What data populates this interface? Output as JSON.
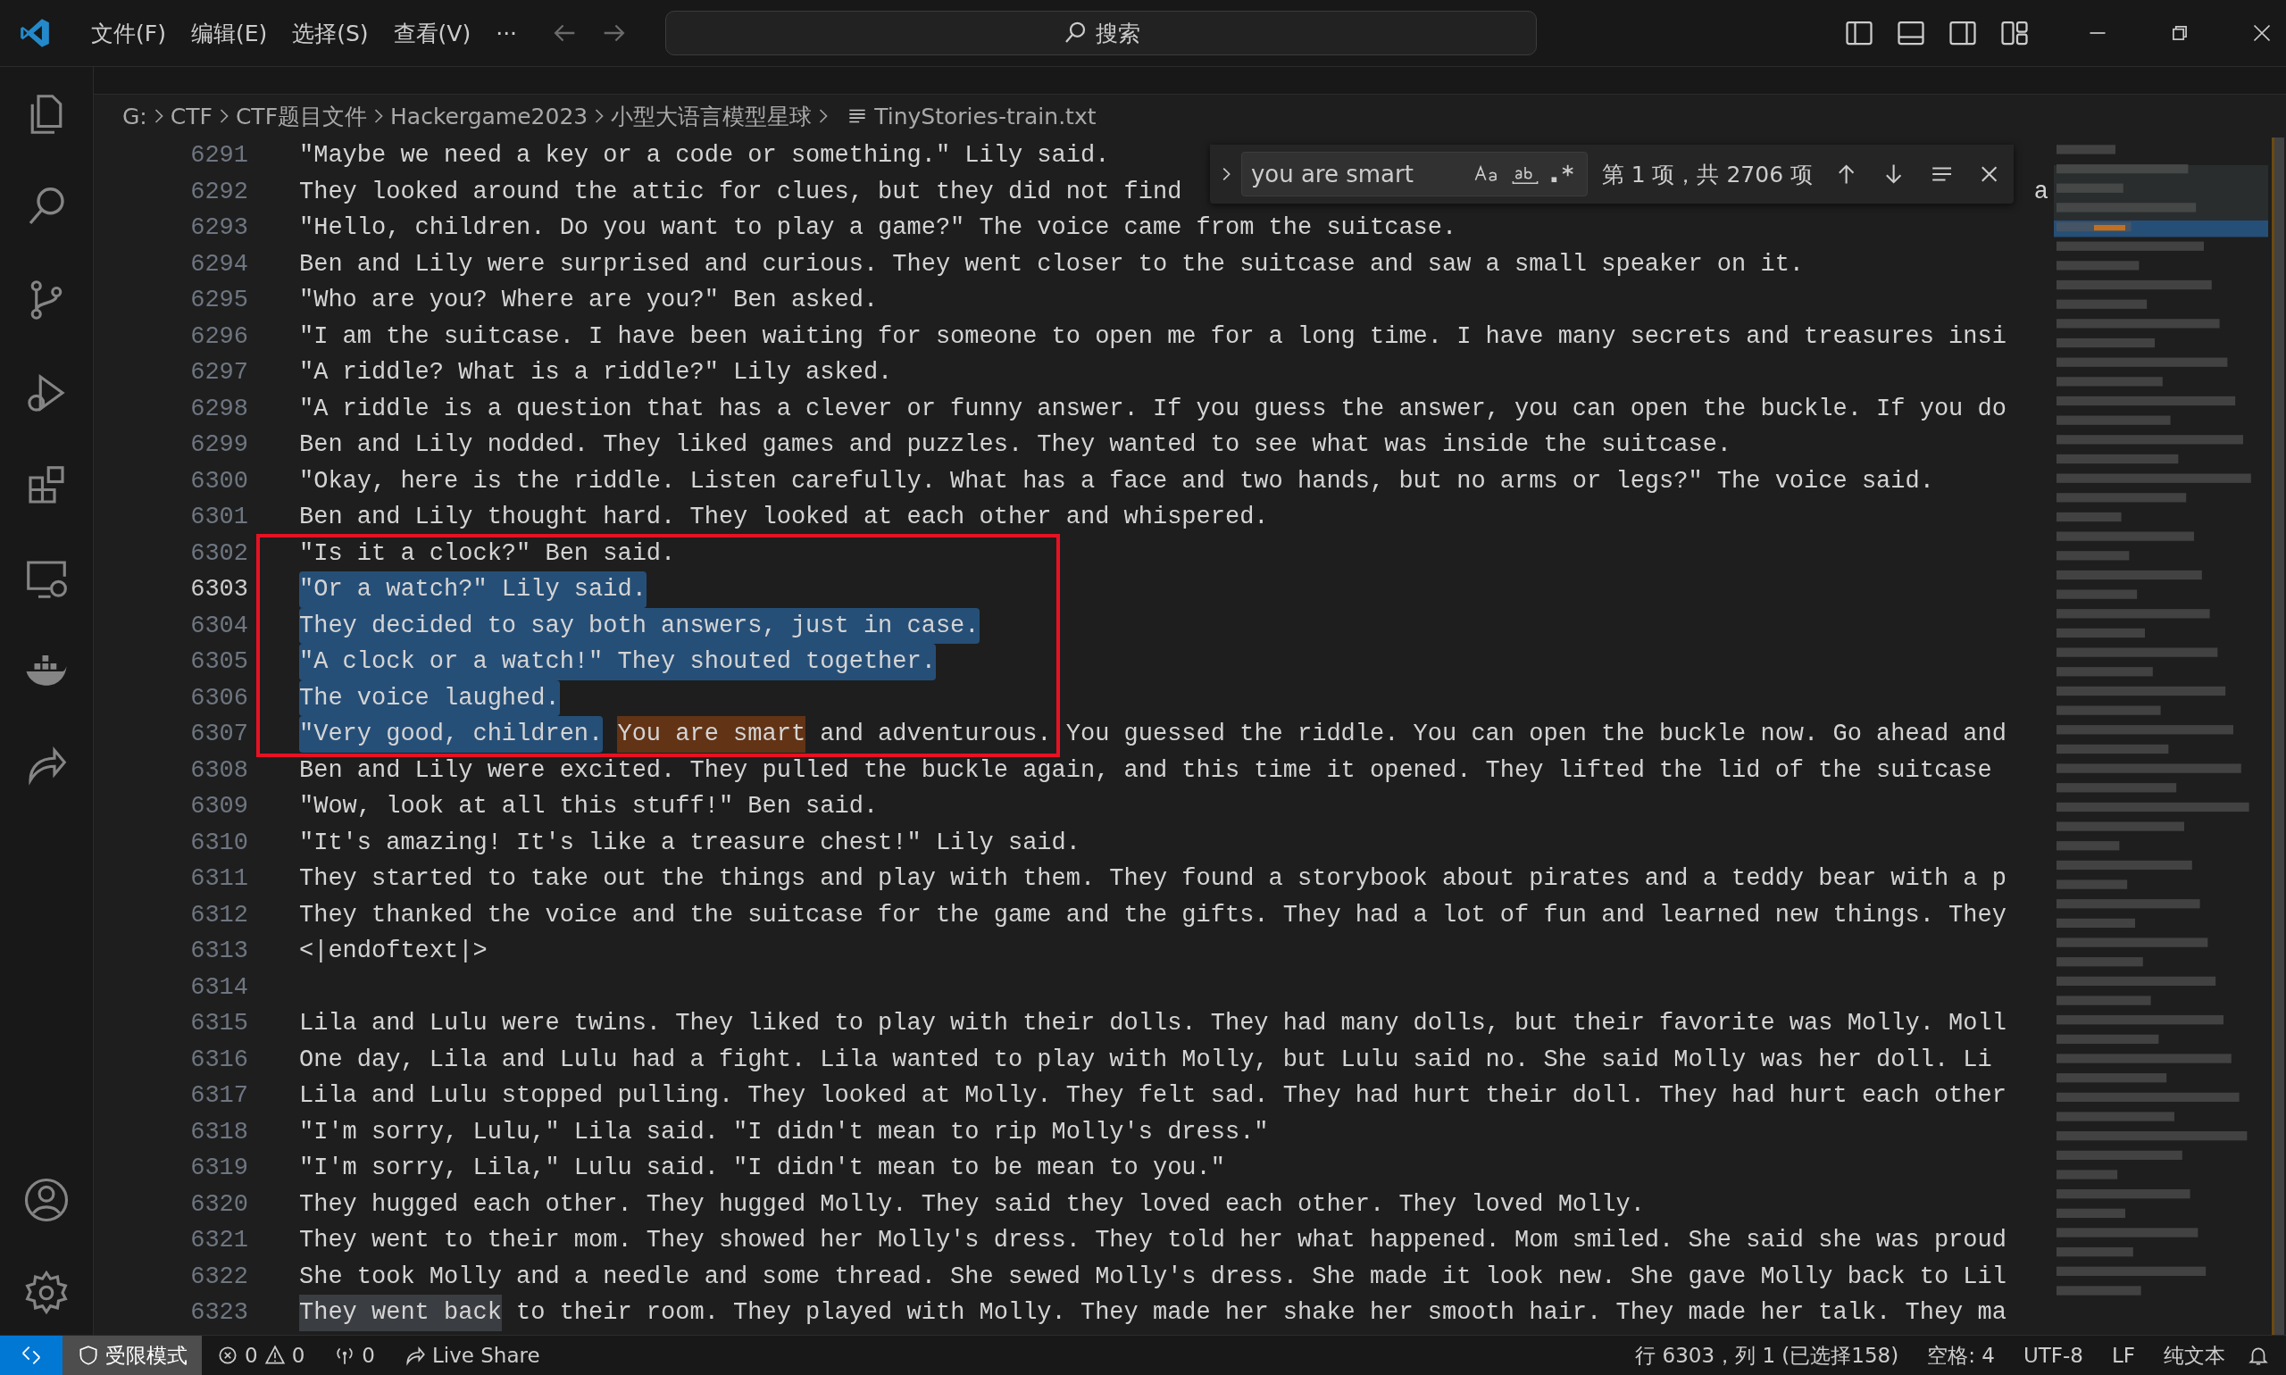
{
  "title_bar": {
    "menus": [
      "文件(F)",
      "编辑(E)",
      "选择(S)",
      "查看(V)"
    ],
    "more": "···",
    "search": "搜索"
  },
  "breadcrumb": [
    "G:",
    "CTF",
    "CTF题目文件",
    "Hackergame2023",
    "小型大语言模型星球",
    "TinyStories-train.txt"
  ],
  "find": {
    "value": "you are smart",
    "match_case": false,
    "whole_word": false,
    "regex": false,
    "result": "第 1 项，共 2706 项"
  },
  "annotation": {
    "kind": "rectangle"
  },
  "editor": {
    "lines": [
      {
        "number": "6291",
        "current": false,
        "segments": [
          {
            "kind": "plain",
            "text": "\"Maybe we need a key or a code or something.\" Lily said."
          }
        ]
      },
      {
        "number": "6292",
        "current": false,
        "segments": [
          {
            "kind": "plain",
            "text": "They looked around the attic for clues, but they did not find"
          }
        ],
        "tail": "a"
      },
      {
        "number": "6293",
        "current": false,
        "segments": [
          {
            "kind": "plain",
            "text": "\"Hello, children. Do you want to play a game?\" The voice came from the suitcase."
          }
        ]
      },
      {
        "number": "6294",
        "current": false,
        "segments": [
          {
            "kind": "plain",
            "text": "Ben and Lily were surprised and curious. They went closer to the suitcase and saw a small speaker on it."
          }
        ]
      },
      {
        "number": "6295",
        "current": false,
        "segments": [
          {
            "kind": "plain",
            "text": "\"Who are you? Where are you?\" Ben asked."
          }
        ]
      },
      {
        "number": "6296",
        "current": false,
        "segments": [
          {
            "kind": "plain",
            "text": "\"I am the suitcase. I have been waiting for someone to open me for a long time. I have many secrets and treasures insi"
          }
        ]
      },
      {
        "number": "6297",
        "current": false,
        "segments": [
          {
            "kind": "plain",
            "text": "\"A riddle? What is a riddle?\" Lily asked."
          }
        ]
      },
      {
        "number": "6298",
        "current": false,
        "segments": [
          {
            "kind": "plain",
            "text": "\"A riddle is a question that has a clever or funny answer. If you guess the answer, you can open the buckle. If you do"
          }
        ]
      },
      {
        "number": "6299",
        "current": false,
        "segments": [
          {
            "kind": "plain",
            "text": "Ben and Lily nodded. They liked games and puzzles. They wanted to see what was inside the suitcase."
          }
        ]
      },
      {
        "number": "6300",
        "current": false,
        "segments": [
          {
            "kind": "plain",
            "text": "\"Okay, here is the riddle. Listen carefully. What has a face and two hands, but no arms or legs?\" The voice said."
          }
        ]
      },
      {
        "number": "6301",
        "current": false,
        "segments": [
          {
            "kind": "plain",
            "text": "Ben and Lily thought hard. They looked at each other and whispered."
          }
        ]
      },
      {
        "number": "6302",
        "current": false,
        "segments": [
          {
            "kind": "plain",
            "text": "\"Is it a clock?\" Ben said."
          }
        ]
      },
      {
        "number": "6303",
        "current": true,
        "segments": [
          {
            "kind": "selection",
            "text": "\"Or a watch?\" Lily said."
          }
        ]
      },
      {
        "number": "6304",
        "current": false,
        "segments": [
          {
            "kind": "selection",
            "text": "They decided to say both answers, just in case."
          }
        ]
      },
      {
        "number": "6305",
        "current": false,
        "segments": [
          {
            "kind": "selection",
            "text": "\"A clock or a watch!\" They shouted together."
          }
        ]
      },
      {
        "number": "6306",
        "current": false,
        "segments": [
          {
            "kind": "selection",
            "text": "The voice laughed."
          }
        ]
      },
      {
        "number": "6307",
        "current": false,
        "segments": [
          {
            "kind": "selection",
            "text": "\"Very good, children."
          },
          {
            "kind": "match",
            "text": "You are smart"
          },
          {
            "kind": "plain",
            "text": " and adventurous. You guessed the riddle. You can open the buckle now. Go ahead and"
          }
        ]
      },
      {
        "number": "6308",
        "current": false,
        "segments": [
          {
            "kind": "plain",
            "text": "Ben and Lily were excited. They pulled the buckle again, and this time it opened. They lifted the lid of the suitcase"
          }
        ]
      },
      {
        "number": "6309",
        "current": false,
        "segments": [
          {
            "kind": "plain",
            "text": "\"Wow, look at all this stuff!\" Ben said."
          }
        ]
      },
      {
        "number": "6310",
        "current": false,
        "segments": [
          {
            "kind": "plain",
            "text": "\"It's amazing! It's like a treasure chest!\" Lily said."
          }
        ]
      },
      {
        "number": "6311",
        "current": false,
        "segments": [
          {
            "kind": "plain",
            "text": "They started to take out the things and play with them. They found a storybook about pirates and a teddy bear with a p"
          }
        ]
      },
      {
        "number": "6312",
        "current": false,
        "segments": [
          {
            "kind": "plain",
            "text": "They thanked the voice and the suitcase for the game and the gifts. They had a lot of fun and learned new things. They"
          }
        ]
      },
      {
        "number": "6313",
        "current": false,
        "segments": [
          {
            "kind": "plain",
            "text": "<|endoftext|>"
          }
        ]
      },
      {
        "number": "6314",
        "current": false
      },
      {
        "number": "6315",
        "current": false,
        "segments": [
          {
            "kind": "plain",
            "text": "Lila and Lulu were twins. They liked to play with their dolls. They had many dolls, but their favorite was Molly. Moll"
          }
        ]
      },
      {
        "number": "6316",
        "current": false,
        "segments": [
          {
            "kind": "plain",
            "text": "One day, Lila and Lulu had a fight. Lila wanted to play with Molly, but Lulu said no. She said Molly was her doll. Li"
          }
        ]
      },
      {
        "number": "6317",
        "current": false,
        "segments": [
          {
            "kind": "plain",
            "text": "Lila and Lulu stopped pulling. They looked at Molly. They felt sad. They had hurt their doll. They had hurt each other"
          }
        ]
      },
      {
        "number": "6318",
        "current": false,
        "segments": [
          {
            "kind": "plain",
            "text": "\"I'm sorry, Lulu,\" Lila said. \"I didn't mean to rip Molly's dress.\""
          }
        ]
      },
      {
        "number": "6319",
        "current": false,
        "segments": [
          {
            "kind": "plain",
            "text": "\"I'm sorry, Lila,\" Lulu said. \"I didn't mean to be mean to you.\""
          }
        ]
      },
      {
        "number": "6320",
        "current": false,
        "segments": [
          {
            "kind": "plain",
            "text": "They hugged each other. They hugged Molly. They said they loved each other. They loved Molly."
          }
        ]
      },
      {
        "number": "6321",
        "current": false,
        "segments": [
          {
            "kind": "plain",
            "text": "They went to their mom. They showed her Molly's dress. They told her what happened. Mom smiled. She said she was proud"
          }
        ]
      },
      {
        "number": "6322",
        "current": false,
        "segments": [
          {
            "kind": "plain",
            "text": "She took Molly and a needle and some thread. She sewed Molly's dress. She made it look new. She gave Molly back to Lil"
          }
        ]
      },
      {
        "number": "6323",
        "current": false,
        "segments": [
          {
            "kind": "highlight",
            "text": "They went back"
          },
          {
            "kind": "plain",
            "text": " to their room. They played with Molly. They made her shake her smooth hair. They made her talk. They ma"
          }
        ]
      }
    ]
  },
  "status_bar": {
    "mode": "受限模式",
    "errors": "0",
    "warnings": "0",
    "ports": "0",
    "live_share": "Live Share",
    "position": "行 6303，列 1 (已选择158)",
    "indent": "空格: 4",
    "encoding": "UTF-8",
    "eol": "LF",
    "language": "纯文本"
  }
}
